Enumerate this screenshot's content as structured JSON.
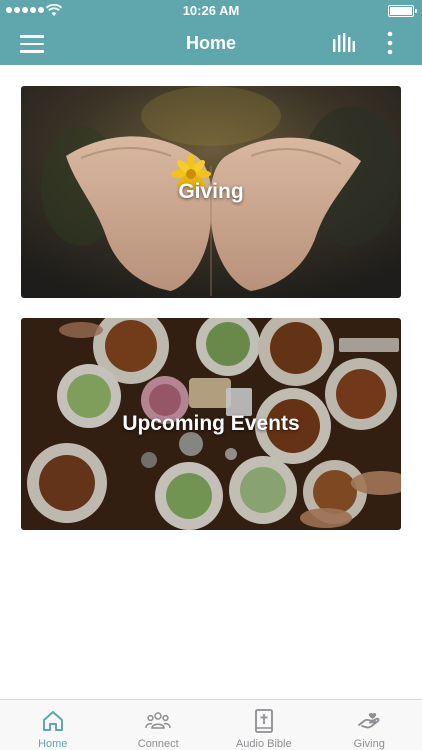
{
  "status_bar": {
    "time": "10:26 AM"
  },
  "nav": {
    "title": "Home",
    "menu_icon": "hamburger-menu-icon",
    "stats_icon": "equalizer-bars-icon",
    "more_icon": "vertical-ellipsis-icon"
  },
  "cards": [
    {
      "label": "Giving"
    },
    {
      "label": "Upcoming Events"
    }
  ],
  "tabs": [
    {
      "label": "Home",
      "icon": "home-icon",
      "active": true
    },
    {
      "label": "Connect",
      "icon": "people-icon",
      "active": false
    },
    {
      "label": "Audio Bible",
      "icon": "bible-icon",
      "active": false
    },
    {
      "label": "Giving",
      "icon": "giving-hand-icon",
      "active": false
    }
  ],
  "colors": {
    "accent": "#5fa7ad",
    "inactive": "#8e8e93",
    "background": "#ffffff"
  }
}
